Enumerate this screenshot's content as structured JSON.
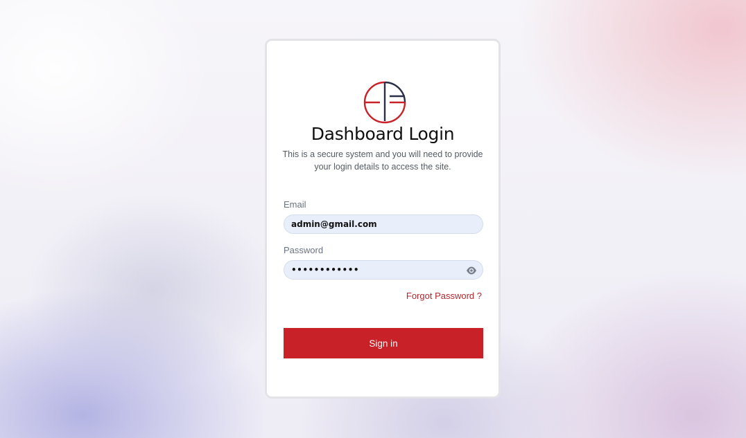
{
  "brand": {
    "logo_icon": "circle-monogram-logo",
    "colors": {
      "red": "#c92128",
      "navy": "#2a2f45"
    }
  },
  "login": {
    "title": "Dashboard Login",
    "subtitle": "This is a secure system and you will need to provide your login details to access the site.",
    "email_label": "Email",
    "email_value": "admin@gmail.com",
    "password_label": "Password",
    "password_value": "••••••••••••",
    "show_password_icon": "eye-icon",
    "forgot_link": "Forgot Password ?",
    "signin_label": "Sign in"
  }
}
